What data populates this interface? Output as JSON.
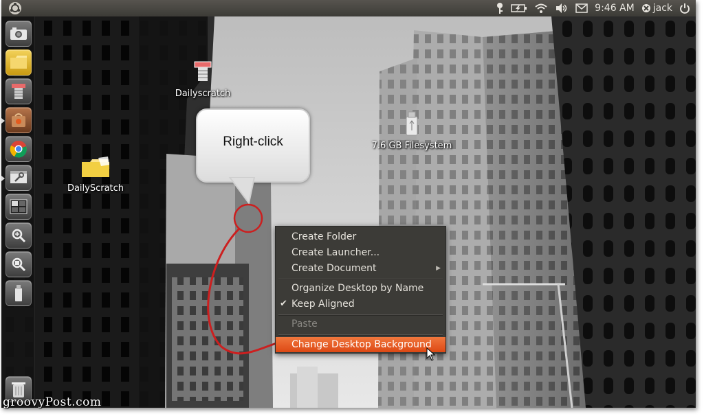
{
  "panel": {
    "clock": "9:46 AM",
    "user": "jack",
    "indicators": [
      "key-icon",
      "battery-icon",
      "wifi-icon",
      "volume-icon",
      "mail-icon"
    ]
  },
  "launcher": {
    "items": [
      "camera-icon",
      "folder-icon",
      "dailyscratch-icon",
      "software-center-icon",
      "chrome-icon",
      "system-settings-icon",
      "workspace-switcher-icon",
      "zoom-icon",
      "search-files-icon",
      "usb-drive-icon",
      "trash-icon"
    ]
  },
  "desktop": {
    "icons": [
      {
        "label": "Dailyscratch"
      },
      {
        "label": "DailyScratch"
      },
      {
        "label": "7.6 GB Filesystem"
      }
    ]
  },
  "callout": {
    "text": "Right-click"
  },
  "context_menu": {
    "items": [
      {
        "label": "Create Folder"
      },
      {
        "label": "Create Launcher..."
      },
      {
        "label": "Create Document"
      },
      {
        "label": "Organize Desktop by Name"
      },
      {
        "label": "Keep Aligned"
      },
      {
        "label": "Paste"
      },
      {
        "label": "Change Desktop Background"
      }
    ]
  },
  "colors": {
    "panel": "#3c3b37",
    "menu_bg": "#3c3b37",
    "highlight": "#dd4814",
    "annotation": "#cc1f1f"
  },
  "watermark": "groovyPost.com"
}
